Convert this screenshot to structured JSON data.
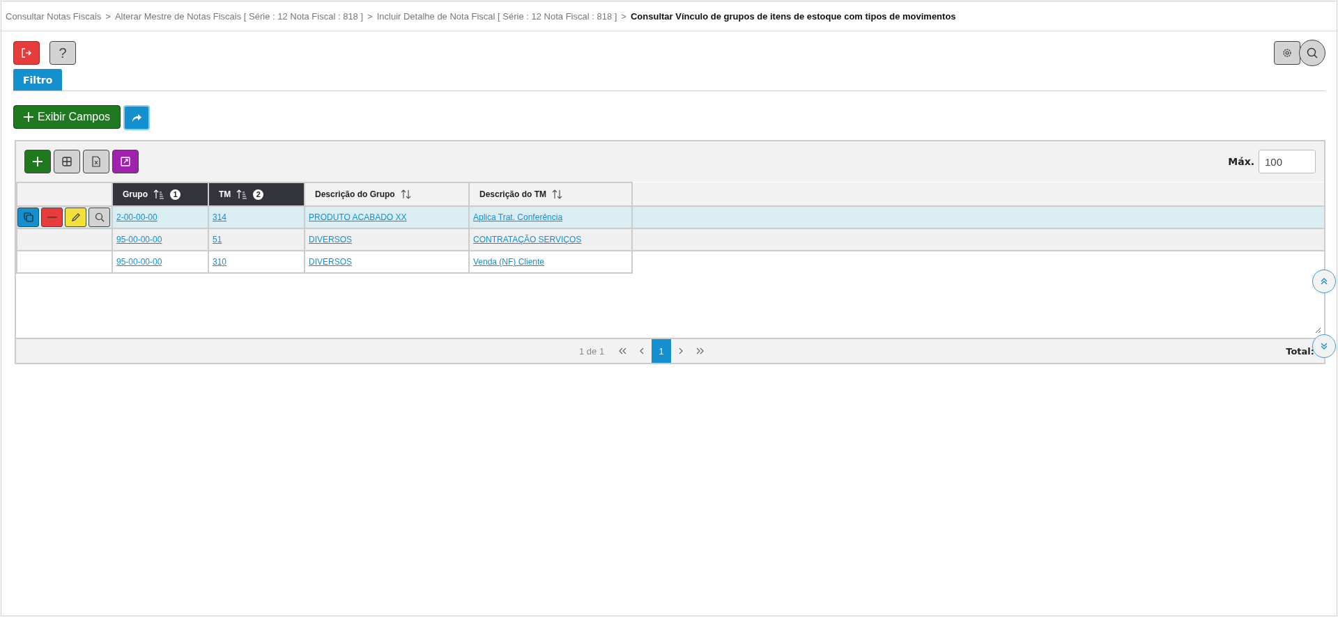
{
  "breadcrumb": [
    {
      "label": "Consultar Notas Fiscais",
      "current": false
    },
    {
      "label": "Alterar Mestre de Notas Fiscais [ Série : 12 Nota Fiscal : 818 ]",
      "current": false
    },
    {
      "label": "Incluir Detalhe de Nota Fiscal [ Série : 12 Nota Fiscal : 818 ]",
      "current": false
    },
    {
      "label": "Consultar Vínculo de grupos de itens de estoque com tipos de movimentos",
      "current": true
    }
  ],
  "separator": ">",
  "help_button": {
    "label": "?"
  },
  "tabs": [
    {
      "label": "Filtro",
      "selected": true
    }
  ],
  "show_fields_button": {
    "label": "Exibir Campos"
  },
  "max_field": {
    "label": "Máx.",
    "value": "100"
  },
  "table": {
    "columns": [
      {
        "label": "Grupo",
        "sorted": true,
        "sort_order": "1"
      },
      {
        "label": "TM",
        "sorted": true,
        "sort_order": "2"
      },
      {
        "label": "Descrição do Grupo",
        "sorted": false
      },
      {
        "label": "Descrição do TM",
        "sorted": false
      }
    ],
    "rows": [
      {
        "selected": true,
        "cells": [
          "2-00-00-00",
          "314",
          "PRODUTO ACABADO XX",
          "Aplica Trat. Conferência"
        ]
      },
      {
        "selected": false,
        "cells": [
          "95-00-00-00",
          "51",
          "DIVERSOS",
          "CONTRATAÇÃO SERVIÇOS"
        ]
      },
      {
        "selected": false,
        "cells": [
          "95-00-00-00",
          "310",
          "DIVERSOS",
          "Venda (NF) Cliente"
        ]
      }
    ]
  },
  "pagination": {
    "summary": "1 de 1",
    "pages": [
      {
        "label": "1",
        "selected": true
      }
    ],
    "total_label": "Total:"
  }
}
